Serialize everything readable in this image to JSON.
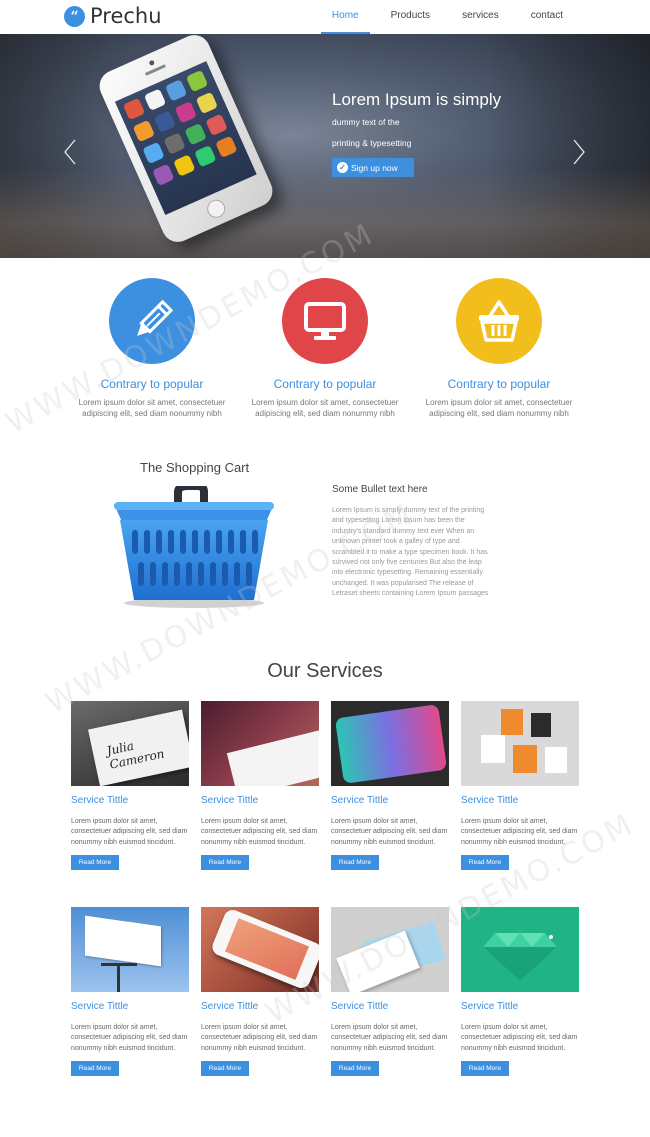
{
  "header": {
    "logo_mark": "“",
    "logo_text": "Prechu",
    "nav": [
      {
        "label": "Home",
        "active": true
      },
      {
        "label": "Products",
        "active": false
      },
      {
        "label": "services",
        "active": false
      },
      {
        "label": "contact",
        "active": false
      }
    ]
  },
  "hero": {
    "title": "Lorem Ipsum is simply",
    "sub1": "dummy text of the",
    "sub2": "printing & typesetting",
    "button_label": "Sign up now",
    "button_icon": "check-circle-icon"
  },
  "features": [
    {
      "title": "Contrary to popular",
      "text": "Lorem ipsum dolor sit amet, consectetuer adipiscing elit, sed diam nonummy nibh",
      "color": "#3d8fe0",
      "icon": "pencil-icon"
    },
    {
      "title": "Contrary to popular",
      "text": "Lorem ipsum dolor sit amet, consectetuer adipiscing elit, sed diam nonummy nibh",
      "color": "#e0454a",
      "icon": "monitor-icon"
    },
    {
      "title": "Contrary to popular",
      "text": "Lorem ipsum dolor sit amet, consectetuer adipiscing elit, sed diam nonummy nibh",
      "color": "#f2be1c",
      "icon": "basket-icon"
    }
  ],
  "cart": {
    "title": "The Shopping Cart",
    "bullet_title": "Some Bullet text here",
    "bullet_text": "Lorem Ipsum is simply dummy text of the printing and typesetting Lorem Ipsum has been the industry's standard dummy text ever When an unknown printer took a galley of type and scrambled it to make a type specimen book. It has survived not only five centuries But also the leap into electronic typesetting. Remaining essentially unchanged. It was popularised The release of Letraset sheets containing Lorem Ipsum passages"
  },
  "services": {
    "title": "Our Services",
    "cards": [
      {
        "title": "Service Tittle",
        "text": "Lorem ipsum dolor sit amet, consectetuer adipiscing elit, sed diam nonummy nibh euismod tincidunt.",
        "button": "Read More",
        "thumb_text": "Julia Cameron"
      },
      {
        "title": "Service Tittle",
        "text": "Lorem ipsum dolor sit amet, consectetuer adipiscing elit, sed diam nonummy nibh euismod tincidunt.",
        "button": "Read More"
      },
      {
        "title": "Service Tittle",
        "text": "Lorem ipsum dolor sit amet, consectetuer adipiscing elit, sed diam nonummy nibh euismod tincidunt.",
        "button": "Read More"
      },
      {
        "title": "Service Tittle",
        "text": "Lorem ipsum dolor sit amet, consectetuer adipiscing elit, sed diam nonummy nibh euismod tincidunt.",
        "button": "Read More"
      },
      {
        "title": "Service Tittle",
        "text": "Lorem ipsum dolor sit amet, consectetuer adipiscing elit, sed diam nonummy nibh euismod tincidunt.",
        "button": "Read More"
      },
      {
        "title": "Service Tittle",
        "text": "Lorem ipsum dolor sit amet, consectetuer adipiscing elit, sed diam nonummy nibh euismod tincidunt.",
        "button": "Read More"
      },
      {
        "title": "Service Tittle",
        "text": "Lorem ipsum dolor sit amet, consectetuer adipiscing elit, sed diam nonummy nibh euismod tincidunt.",
        "button": "Read More"
      },
      {
        "title": "Service Tittle",
        "text": "Lorem ipsum dolor sit amet, consectetuer adipiscing elit, sed diam nonummy nibh euismod tincidunt.",
        "button": "Read More"
      }
    ]
  },
  "watermark": "WWW.DOWNDEMO.COM",
  "colors": {
    "accent": "#3d8fe0",
    "red": "#e0454a",
    "yellow": "#f2be1c"
  }
}
